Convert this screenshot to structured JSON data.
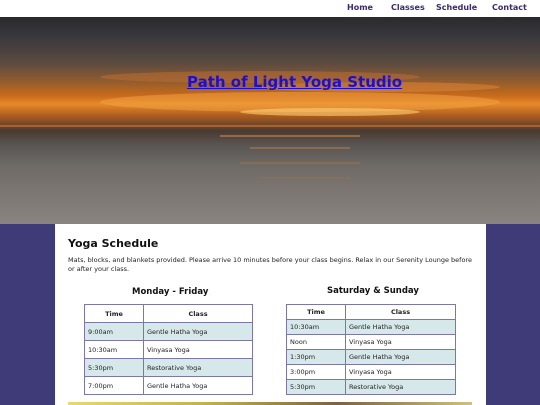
{
  "nav": {
    "home": "Home",
    "classes": "Classes",
    "schedule": "Schedule",
    "contact": "Contact"
  },
  "hero": {
    "title": "Path of Light Yoga Studio"
  },
  "main": {
    "title": "Yoga Schedule",
    "description": "Mats, blocks, and blankets provided. Please arrive 10 minutes before your class begins. Relax in our Serenity Lounge before or after your class."
  },
  "weekday": {
    "heading": "Monday - Friday",
    "col_time": "Time",
    "col_class": "Class",
    "rows": [
      {
        "time": "9:00am",
        "class": "Gentle Hatha Yoga"
      },
      {
        "time": "10:30am",
        "class": "Vinyasa Yoga"
      },
      {
        "time": "5:30pm",
        "class": "Restorative Yoga"
      },
      {
        "time": "7:00pm",
        "class": "Gentle Hatha Yoga"
      }
    ]
  },
  "weekend": {
    "heading": "Saturday & Sunday",
    "col_time": "Time",
    "col_class": "Class",
    "rows": [
      {
        "time": "10:30am",
        "class": "Gentle Hatha Yoga"
      },
      {
        "time": "Noon",
        "class": "Vinyasa Yoga"
      },
      {
        "time": "1:30pm",
        "class": "Gentle Hatha Yoga"
      },
      {
        "time": "3:00pm",
        "class": "Vinyasa Yoga"
      },
      {
        "time": "5:30pm",
        "class": "Restorative Yoga"
      }
    ]
  },
  "colors": {
    "page_bg": "#3f3a78",
    "nav_text": "#3c2a6e",
    "alt_row": "#d7e8ea",
    "title_link": "#1a0fd6"
  }
}
